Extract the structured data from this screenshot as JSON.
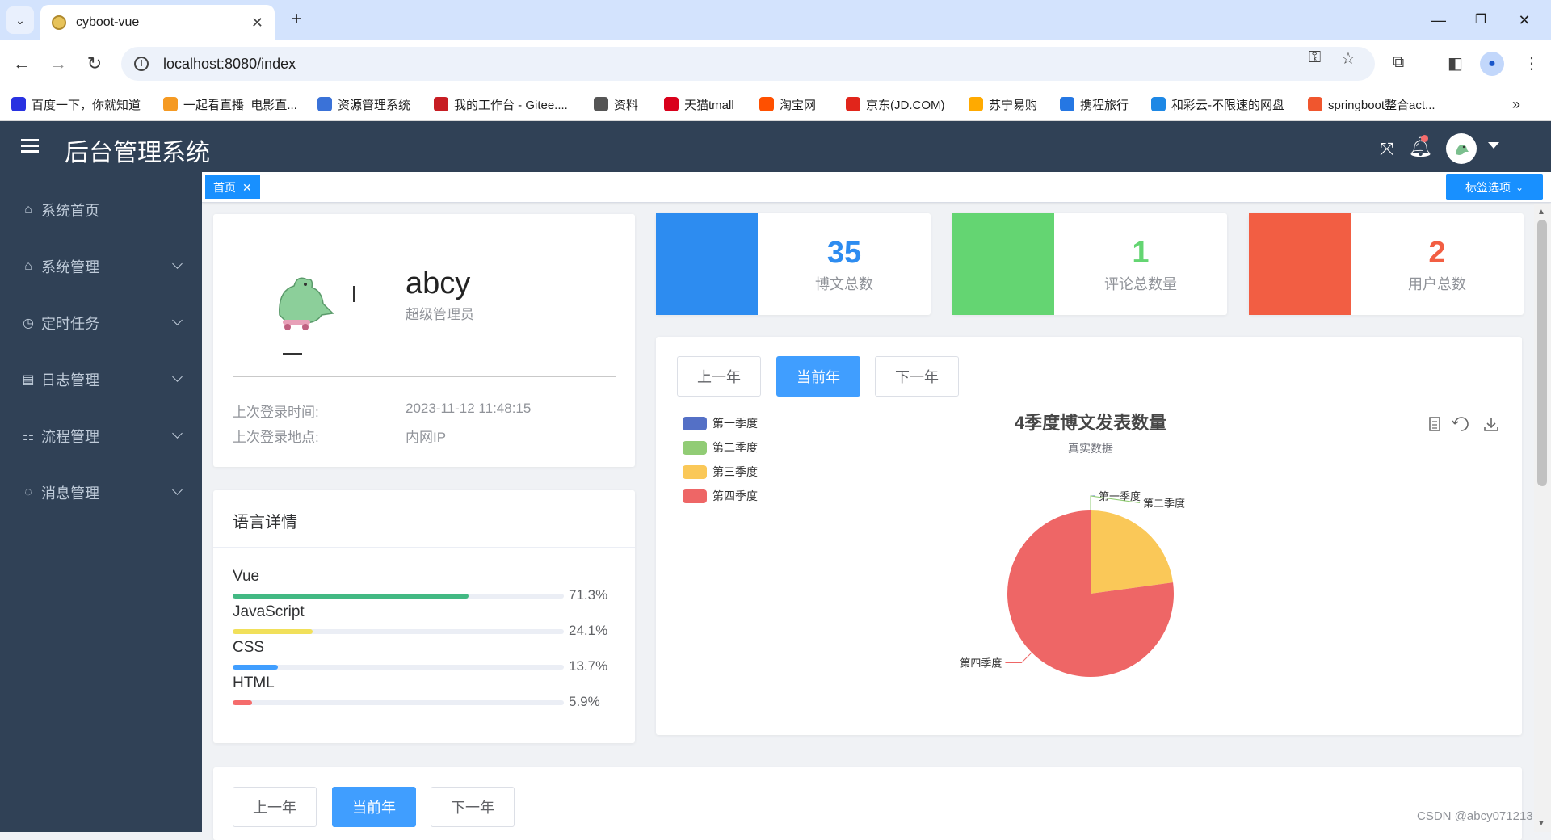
{
  "browser": {
    "tab_title": "cyboot-vue",
    "url": "localhost:8080/index",
    "bookmarks": [
      {
        "label": "百度一下，你就知道",
        "color": "#2932e1"
      },
      {
        "label": "一起看直播_电影直...",
        "color": "#f59a23"
      },
      {
        "label": "资源管理系统",
        "color": "#3a72d8"
      },
      {
        "label": "我的工作台 - Gitee....",
        "color": "#c71d23"
      },
      {
        "label": "资料",
        "color": "#555555"
      },
      {
        "label": "天猫tmall",
        "color": "#d9001b"
      },
      {
        "label": "淘宝网",
        "color": "#ff5000"
      },
      {
        "label": "京东(JD.COM)",
        "color": "#e1251b"
      },
      {
        "label": "苏宁易购",
        "color": "#ffaa00"
      },
      {
        "label": "携程旅行",
        "color": "#2577e3"
      },
      {
        "label": "和彩云-不限速的网盘",
        "color": "#1e88e5"
      },
      {
        "label": "springboot整合act...",
        "color": "#f0562e"
      }
    ]
  },
  "header": {
    "title": "后台管理系统"
  },
  "sidebar": {
    "items": [
      {
        "label": "系统首页",
        "icon": "home-icon"
      },
      {
        "label": "系统管理",
        "icon": "home-icon"
      },
      {
        "label": "定时任务",
        "icon": "clock-icon"
      },
      {
        "label": "日志管理",
        "icon": "log-icon"
      },
      {
        "label": "流程管理",
        "icon": "flow-icon"
      },
      {
        "label": "消息管理",
        "icon": "message-icon"
      }
    ]
  },
  "tags_view": {
    "active_tag": "首页",
    "options_label": "标签选项"
  },
  "user_card": {
    "name": "abcy",
    "role": "超级管理员",
    "last_login_time_label": "上次登录时间:",
    "last_login_time": "2023-11-12 11:48:15",
    "last_login_place_label": "上次登录地点:",
    "last_login_place": "内网IP"
  },
  "language_card": {
    "title": "语言详情",
    "languages": [
      {
        "name": "Vue",
        "percent": "71.3%",
        "value": 71.3,
        "color": "#42b983"
      },
      {
        "name": "JavaScript",
        "percent": "24.1%",
        "value": 24.1,
        "color": "#f1e05a"
      },
      {
        "name": "CSS",
        "percent": "13.7%",
        "value": 13.7,
        "color": "#409eff"
      },
      {
        "name": "HTML",
        "percent": "5.9%",
        "value": 5.9,
        "color": "#f56c6c"
      }
    ]
  },
  "stats": [
    {
      "value": "35",
      "label": "博文总数",
      "color": "#2d8cf0"
    },
    {
      "value": "1",
      "label": "评论总数量",
      "color": "#64d572"
    },
    {
      "value": "2",
      "label": "用户总数",
      "color": "#f25e43"
    }
  ],
  "year_buttons": {
    "prev": "上一年",
    "current": "当前年",
    "next": "下一年"
  },
  "chart_data": {
    "type": "pie",
    "title": "4季度博文发表数量",
    "subtitle": "真实数据",
    "legend_position": "top-left",
    "categories": [
      "第一季度",
      "第二季度",
      "第三季度",
      "第四季度"
    ],
    "values": [
      0,
      0,
      8,
      27
    ],
    "colors": [
      "#5470c6",
      "#91cc75",
      "#fac858",
      "#ee6666"
    ]
  },
  "watermark": "CSDN @abcy071213"
}
